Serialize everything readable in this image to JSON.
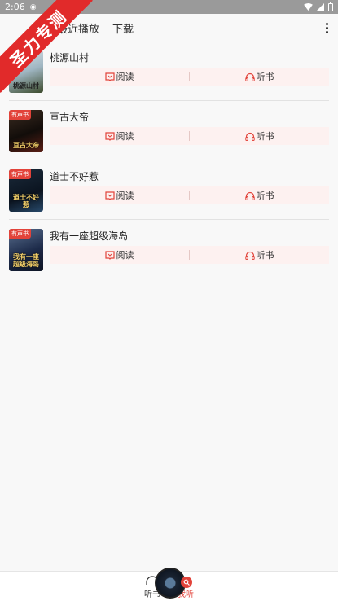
{
  "status": {
    "time": "2:06"
  },
  "ribbon": {
    "text": "圣力专测"
  },
  "tabs": [
    {
      "label": "最近播放"
    },
    {
      "label": "下载"
    }
  ],
  "books": [
    {
      "title": "桃源山村",
      "badge": "",
      "cover_text": "桃源山村",
      "read_label": "阅读",
      "listen_label": "听书"
    },
    {
      "title": "亘古大帝",
      "badge": "有声书",
      "cover_text": "亘古大帝",
      "read_label": "阅读",
      "listen_label": "听书"
    },
    {
      "title": "道士不好惹",
      "badge": "有声书",
      "cover_text": "道士不好惹",
      "read_label": "阅读",
      "listen_label": "听书"
    },
    {
      "title": "我有一座超级海岛",
      "badge": "有声书",
      "cover_text": "我有一座超级海岛",
      "read_label": "阅读",
      "listen_label": "听书"
    }
  ],
  "bottom_nav": {
    "listen_label": "听书",
    "mine_label": "我听"
  },
  "colors": {
    "accent": "#e2433a",
    "action_bg": "#fdf1f0"
  }
}
